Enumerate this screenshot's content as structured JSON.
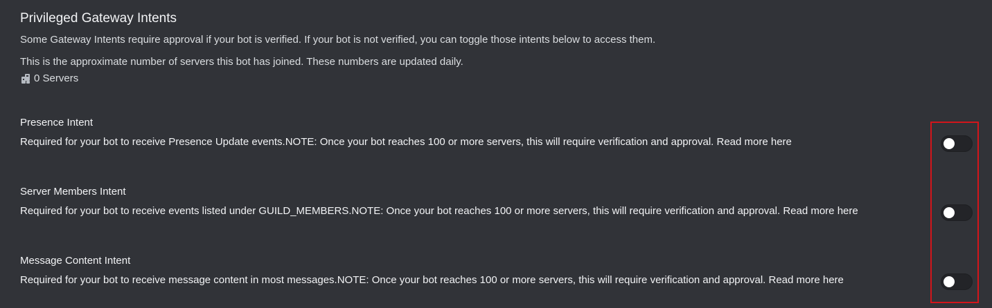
{
  "section": {
    "title": "Privileged Gateway Intents",
    "description": "Some Gateway Intents require approval if your bot is verified. If your bot is not verified, you can toggle those intents below to access them.",
    "server_note": "This is the approximate number of servers this bot has joined. These numbers are updated daily.",
    "server_count": "0 Servers",
    "server_icon": "servers-icon"
  },
  "intents": [
    {
      "title": "Presence Intent",
      "description": "Required for your bot to receive Presence Update events.NOTE: Once your bot reaches 100 or more servers, this will require verification and approval. Read more here",
      "enabled": false
    },
    {
      "title": "Server Members Intent",
      "description": "Required for your bot to receive events listed under GUILD_MEMBERS.NOTE: Once your bot reaches 100 or more servers, this will require verification and approval. Read more here",
      "enabled": false
    },
    {
      "title": "Message Content Intent",
      "description": "Required for your bot to receive message content in most messages.NOTE: Once your bot reaches 100 or more servers, this will require verification and approval. Read more here",
      "enabled": false
    }
  ],
  "colors": {
    "background": "#313338",
    "highlight_border": "#d3151b",
    "toggle_off": "#232428",
    "knob": "#ffffff"
  }
}
